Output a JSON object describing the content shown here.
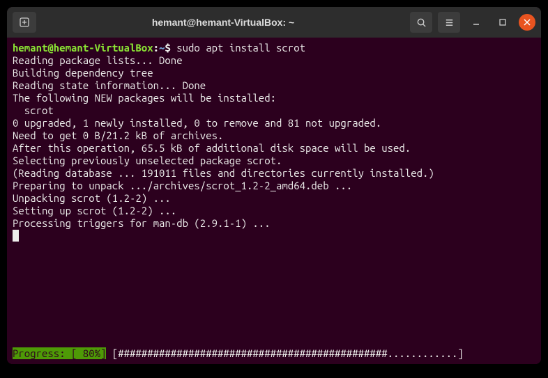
{
  "titlebar": {
    "title": "hemant@hemant-VirtualBox: ~"
  },
  "prompt": {
    "userhost": "hemant@hemant-VirtualBox",
    "sep1": ":",
    "path": "~",
    "sep2": "$",
    "command": "sudo apt install scrot"
  },
  "output": {
    "l1": "Reading package lists... Done",
    "l2": "Building dependency tree",
    "l3": "Reading state information... Done",
    "l4": "The following NEW packages will be installed:",
    "l5": "  scrot",
    "l6": "0 upgraded, 1 newly installed, 0 to remove and 81 not upgraded.",
    "l7": "Need to get 0 B/21.2 kB of archives.",
    "l8": "After this operation, 65.5 kB of additional disk space will be used.",
    "l9": "Selecting previously unselected package scrot.",
    "l10": "(Reading database ... 191011 files and directories currently installed.)",
    "l11": "Preparing to unpack .../archives/scrot_1.2-2_amd64.deb ...",
    "l12": "Unpacking scrot (1.2-2) ...",
    "l13": "Setting up scrot (1.2-2) ...",
    "l14": "Processing triggers for man-db (2.9.1-1) ..."
  },
  "progress": {
    "label": "Progress: [ 80%]",
    "bar": " [##############################################............] "
  }
}
